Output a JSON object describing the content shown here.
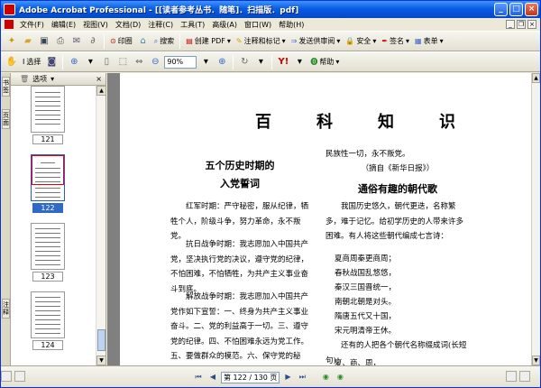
{
  "window": {
    "title": "Adobe Acrobat Professional - [[读者参考丛书．随笔]．扫描版．pdf]"
  },
  "menu": [
    "文件(F)",
    "编辑(E)",
    "视图(V)",
    "文档(D)",
    "注释(C)",
    "工具(T)",
    "高级(A)",
    "窗口(W)",
    "帮助(H)"
  ],
  "toolbar1": {
    "print_label": "印圈",
    "search_label": "搜索",
    "create_pdf_label": "创建 PDF",
    "comment_label": "注释和标记",
    "send_review_label": "发送供审阅",
    "secure_label": "安全",
    "sign_label": "签名",
    "forms_label": "表单"
  },
  "toolbar2": {
    "select_label": "选择",
    "zoom_value": "90%",
    "help_label": "帮助"
  },
  "left_tabs": [
    "书签",
    "页面",
    "注释"
  ],
  "panel": {
    "options_label": "选项",
    "thumbnails": [
      {
        "label": "121",
        "selected": false
      },
      {
        "label": "122",
        "selected": true
      },
      {
        "label": "123",
        "selected": false
      },
      {
        "label": "124",
        "selected": false
      }
    ]
  },
  "document": {
    "page_title": "百　科　知　识",
    "article1": {
      "heading_line1": "五个历史时期的",
      "heading_line2": "入党誓词",
      "paragraphs": [
        "红军时期：严守秘密，服从纪律，牺牲个人，阶级斗争，努力革命，永不叛党。",
        "抗日战争时期：我志愿加入中国共产党，坚决执行党的决议，遵守党的纪律，不怕困难，不怕牺牲，为共产主义事业奋斗到底。",
        "解放战争时期：我志愿加入中国共产党作如下宣誓：一、终身为共产主义事业奋斗。二、党的利益高于一切。三、遵守党的纪律。四、不怕困难永远为党工作。五、要做群众的模范。六、保守党的秘"
      ]
    },
    "col2_top_line1": "民族性一切，永不叛党。",
    "col2_top_line2": "（摘自《新华日报》）",
    "article2": {
      "heading": "通俗有趣的朝代歌",
      "paragraph": "我国历史悠久，朝代更迭，名称繁多，难于记忆。给初学历史的人带来许多困难。有人将这些朝代编成七言诗：",
      "poem": [
        "夏商周秦更商周；",
        "春秋战国乱悠悠，",
        "秦汉三国晋统一，",
        "南朝北朝是对头。",
        "隋唐五代又十国，",
        "宋元明清帝王休。"
      ],
      "paragraph2": "还有的人把各个朝代名称缀成词(长短句)：",
      "closing": "夏、商、周，"
    }
  },
  "status": {
    "page_indicator": "第 122 / 130 页"
  }
}
